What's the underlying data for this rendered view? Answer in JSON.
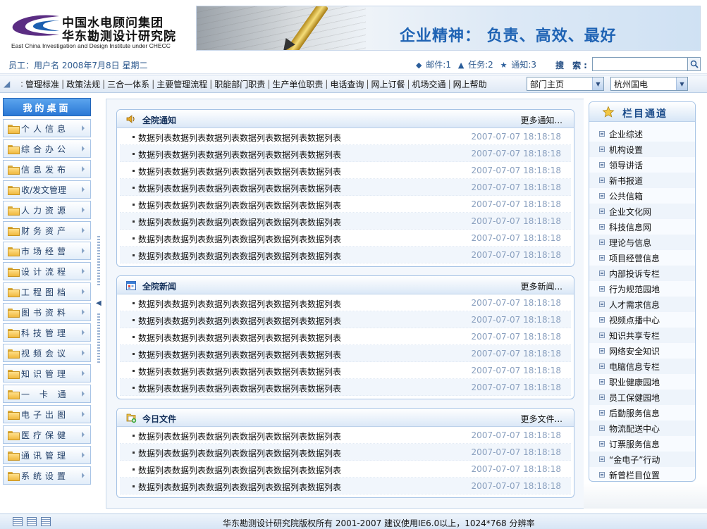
{
  "header": {
    "logo_cn_line1": "中国水电顾问集团",
    "logo_cn_line2": "华东勘测设计研究院",
    "logo_en": "East China Investigation and Design Institute under CHECC",
    "slogan": "企业精神：  负责、高效、最好"
  },
  "infobar": {
    "user_info": "员工：用户名  2008年7月8日  星期二",
    "mail": "邮件:1",
    "tasks": "任务:2",
    "notices": "通知:3",
    "search_label": "搜 索:",
    "search_value": ""
  },
  "nav": {
    "items": [
      "管理标准",
      "政策法规",
      "三合一体系",
      "主要管理流程",
      "职能部门职责",
      "生产单位职责",
      "电话查询",
      "网上订餐",
      "机场交通",
      "网上帮助"
    ],
    "select_home": "部门主页",
    "select_city": "杭州国电"
  },
  "sidebar": {
    "title": "我的桌面",
    "items": [
      "个人信息",
      "综合办公",
      "信息发布",
      "收/发文管理",
      "人力资源",
      "财务资产",
      "市场经营",
      "设计流程",
      "工程图档",
      "图书资料",
      "科技管理",
      "视频会议",
      "知识管理",
      "一 卡 通",
      "电子出图",
      "医疗保健",
      "通讯管理",
      "系统设置"
    ]
  },
  "panels": {
    "notice": {
      "title": "全院通知",
      "more": "更多通知...",
      "rows": [
        {
          "text": "数据列表数据列表数据列表数据列表数据列表数据列表",
          "date": "2007-07-07 18:18:18"
        },
        {
          "text": "数据列表数据列表数据列表数据列表数据列表数据列表",
          "date": "2007-07-07 18:18:18"
        },
        {
          "text": "数据列表数据列表数据列表数据列表数据列表数据列表",
          "date": "2007-07-07 18:18:18"
        },
        {
          "text": "数据列表数据列表数据列表数据列表数据列表数据列表",
          "date": "2007-07-07 18:18:18"
        },
        {
          "text": "数据列表数据列表数据列表数据列表数据列表数据列表",
          "date": "2007-07-07 18:18:18"
        },
        {
          "text": "数据列表数据列表数据列表数据列表数据列表数据列表",
          "date": "2007-07-07 18:18:18"
        },
        {
          "text": "数据列表数据列表数据列表数据列表数据列表数据列表",
          "date": "2007-07-07 18:18:18"
        },
        {
          "text": "数据列表数据列表数据列表数据列表数据列表数据列表",
          "date": "2007-07-07 18:18:18"
        }
      ]
    },
    "news": {
      "title": "全院新闻",
      "more": "更多新闻...",
      "rows": [
        {
          "text": "数据列表数据列表数据列表数据列表数据列表数据列表",
          "date": "2007-07-07 18:18:18"
        },
        {
          "text": "数据列表数据列表数据列表数据列表数据列表数据列表",
          "date": "2007-07-07 18:18:18"
        },
        {
          "text": "数据列表数据列表数据列表数据列表数据列表数据列表",
          "date": "2007-07-07 18:18:18"
        },
        {
          "text": "数据列表数据列表数据列表数据列表数据列表数据列表",
          "date": "2007-07-07 18:18:18"
        },
        {
          "text": "数据列表数据列表数据列表数据列表数据列表数据列表",
          "date": "2007-07-07 18:18:18"
        },
        {
          "text": "数据列表数据列表数据列表数据列表数据列表数据列表",
          "date": "2007-07-07 18:18:18"
        }
      ]
    },
    "files": {
      "title": "今日文件",
      "more": "更多文件...",
      "rows": [
        {
          "text": "数据列表数据列表数据列表数据列表数据列表数据列表",
          "date": "2007-07-07 18:18:18"
        },
        {
          "text": "数据列表数据列表数据列表数据列表数据列表数据列表",
          "date": "2007-07-07 18:18:18"
        },
        {
          "text": "数据列表数据列表数据列表数据列表数据列表数据列表",
          "date": "2007-07-07 18:18:18"
        },
        {
          "text": "数据列表数据列表数据列表数据列表数据列表数据列表",
          "date": "2007-07-07 18:18:18"
        }
      ]
    }
  },
  "channels": {
    "title": "栏目通道",
    "items": [
      "企业综述",
      "机构设置",
      "领导讲话",
      "新书报道",
      "公共信箱",
      "企业文化网",
      "科技信息网",
      "理论与信息",
      "项目经营信息",
      "内部投诉专栏",
      "行为规范园地",
      "人才需求信息",
      "视频点播中心",
      "知识共享专栏",
      "网络安全知识",
      "电脑信息专栏",
      "职业健康园地",
      "员工保健园地",
      "后勤服务信息",
      "物流配送中心",
      "订票服务信息",
      "“金电子”行动",
      "新曾栏目位置"
    ]
  },
  "footer": {
    "text": "华东勘测设计研究院版权所有 2001-2007 建议使用IE6.0以上，1024*768 分辨率"
  },
  "colors": {
    "accent": "#2a78d6",
    "slogan": "#1f63b4",
    "panel_border": "#a6c3e5",
    "date_text": "#8aa0bf",
    "logo_purple": "#5b2d83",
    "logo_blue": "#1c5fb0"
  },
  "icons": {
    "notice": "speaker-icon",
    "news": "calendar-icon",
    "files": "document-add-icon",
    "channels": "star-icon",
    "search": "magnifier-icon"
  }
}
